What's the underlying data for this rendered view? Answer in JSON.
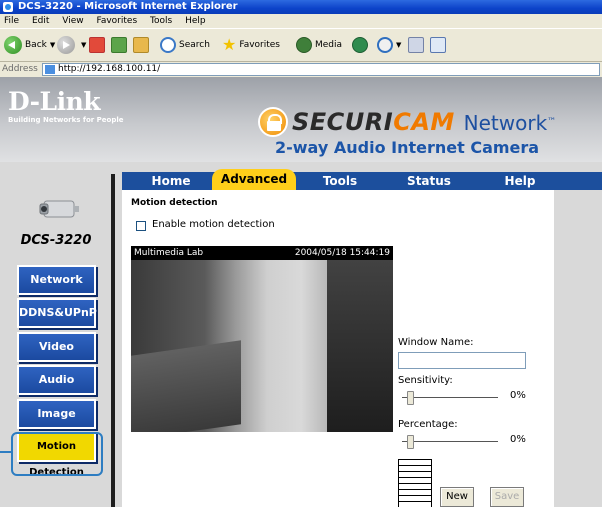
{
  "window": {
    "title": "DCS-3220 - Microsoft Internet Explorer",
    "menus": [
      "File",
      "Edit",
      "View",
      "Favorites",
      "Tools",
      "Help"
    ]
  },
  "toolbar": {
    "back": "Back",
    "search": "Search",
    "favorites": "Favorites",
    "media": "Media"
  },
  "address": {
    "label": "Address",
    "url": "http://192.168.100.11/"
  },
  "header": {
    "brand": "D-Link",
    "brand_tagline": "Building Networks for People",
    "product_sec": "SECURI",
    "product_cam": "CAM",
    "product_network": "Network",
    "tm": "™",
    "product_tagline": "2-way Audio Internet Camera"
  },
  "sidebar": {
    "model": "DCS-3220",
    "items": [
      {
        "label": "Network",
        "active": false
      },
      {
        "label": "DDNS&UPnP",
        "active": false
      },
      {
        "label": "Video",
        "active": false
      },
      {
        "label": "Audio",
        "active": false
      },
      {
        "label": "Image Setting",
        "active": false
      },
      {
        "label": "Motion Detection",
        "active": true
      }
    ]
  },
  "tabs": [
    "Home",
    "Advanced",
    "Tools",
    "Status",
    "Help"
  ],
  "active_tab": "Advanced",
  "content": {
    "section_title": "Motion detection",
    "enable_label": "Enable motion detection",
    "enable_checked": false,
    "video_caption": "Multimedia Lab",
    "video_timestamp": "2004/05/18 15:44:19",
    "window_name_label": "Window Name:",
    "window_name_value": "",
    "sensitivity_label": "Sensitivity:",
    "sensitivity_value": "0%",
    "percentage_label": "Percentage:",
    "percentage_value": "0%",
    "new_button": "New",
    "save_button": "Save"
  },
  "colors": {
    "nav_blue": "#1c4f9d",
    "active_yellow": "#f1d800",
    "tab_active": "#ffcf1a",
    "brand_orange": "#f07a00"
  }
}
